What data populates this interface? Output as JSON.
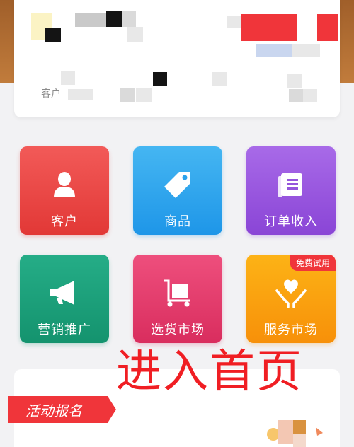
{
  "profile": {
    "customer_label": "客户"
  },
  "tiles": [
    {
      "label": "客户",
      "icon": "customer-icon",
      "color": "#e23836"
    },
    {
      "label": "商品",
      "icon": "tag-icon",
      "color": "#1e96e8"
    },
    {
      "label": "订单收入",
      "icon": "ledger-icon",
      "color": "#8a45d6"
    },
    {
      "label": "营销推广",
      "icon": "megaphone-icon",
      "color": "#14936e"
    },
    {
      "label": "选货市场",
      "icon": "cart-icon",
      "color": "#d92d5e"
    },
    {
      "label": "服务市场",
      "icon": "heart-hands-icon",
      "color": "#f79009",
      "badge": "免费试用"
    }
  ],
  "activity": {
    "title": "活动报名"
  },
  "overlay": {
    "text": "进入首页"
  }
}
